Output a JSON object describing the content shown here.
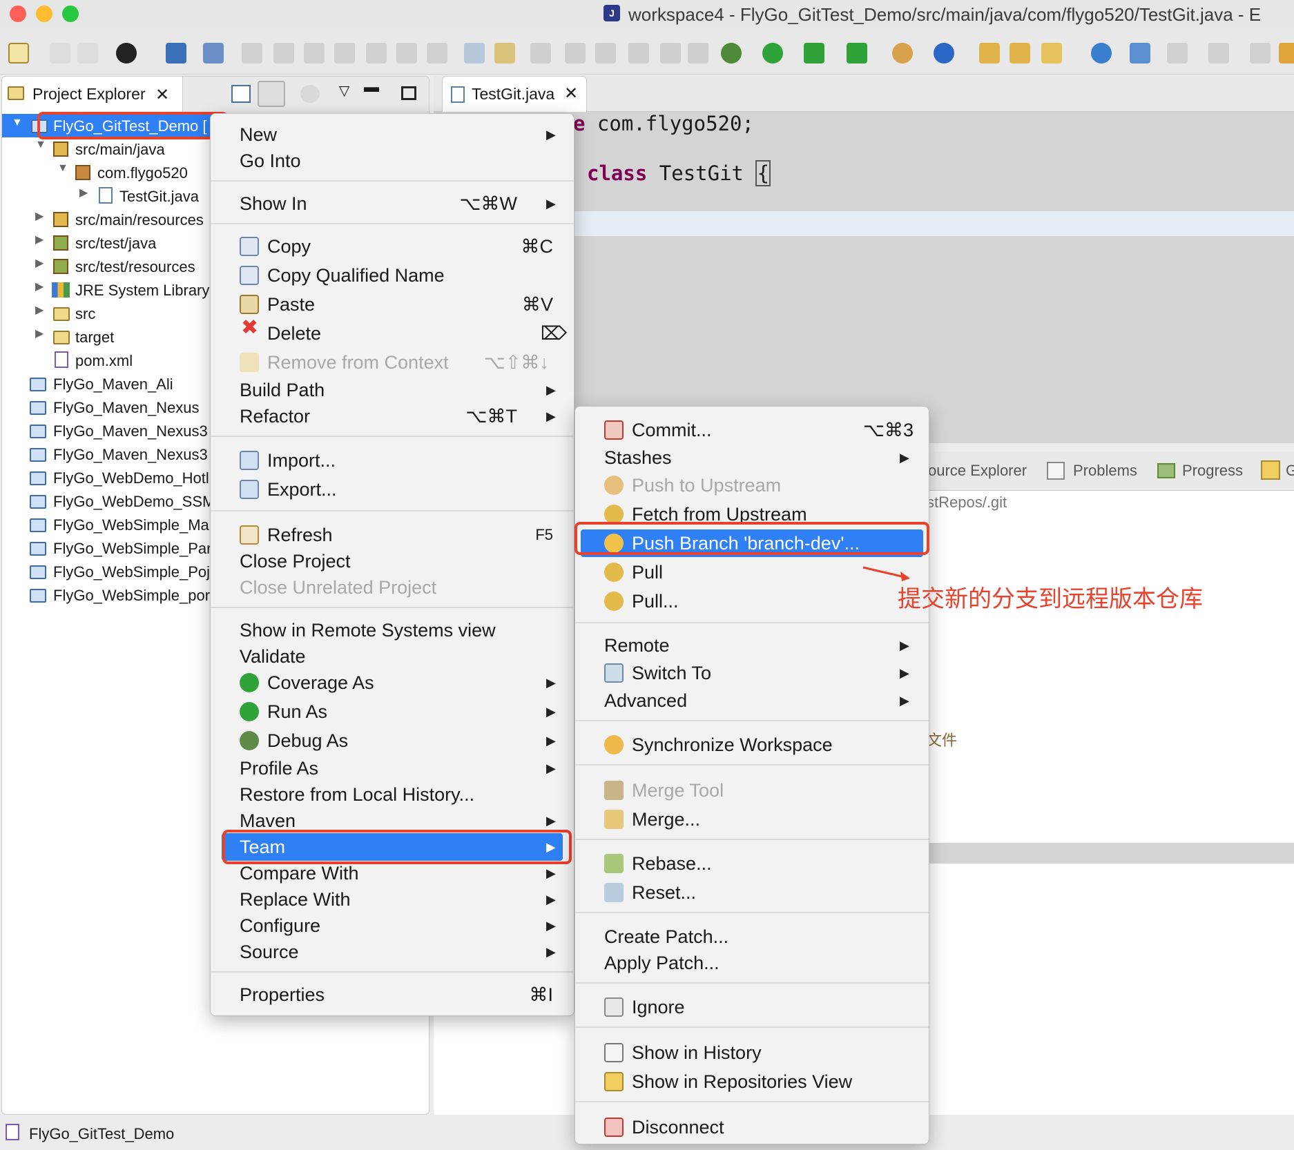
{
  "window": {
    "title": "workspace4 - FlyGo_GitTest_Demo/src/main/java/com/flygo520/TestGit.java - E"
  },
  "explorer": {
    "tab_label": "Project Explorer",
    "tree": [
      {
        "label": "FlyGo_GitTest_Demo [",
        "selected": true
      },
      {
        "label": "src/main/java"
      },
      {
        "label": "com.flygo520"
      },
      {
        "label": "TestGit.java"
      },
      {
        "label": "src/main/resources"
      },
      {
        "label": "src/test/java"
      },
      {
        "label": "src/test/resources"
      },
      {
        "label": "JRE System Library"
      },
      {
        "label": "src"
      },
      {
        "label": "target"
      },
      {
        "label": "pom.xml"
      },
      {
        "label": "FlyGo_Maven_Ali"
      },
      {
        "label": "FlyGo_Maven_Nexus"
      },
      {
        "label": "FlyGo_Maven_Nexus3"
      },
      {
        "label": "FlyGo_Maven_Nexus3"
      },
      {
        "label": "FlyGo_WebDemo_Hotl"
      },
      {
        "label": "FlyGo_WebDemo_SSM"
      },
      {
        "label": "FlyGo_WebSimple_Ma"
      },
      {
        "label": "FlyGo_WebSimple_Par"
      },
      {
        "label": "FlyGo_WebSimple_Poj"
      },
      {
        "label": "FlyGo_WebSimple_por"
      }
    ]
  },
  "editor": {
    "tab_label": "TestGit.java",
    "line1_kw": "e",
    "line1_rest": " com.flygo520;",
    "line2_kw": "class",
    "line2_rest": " TestGit ",
    "line2_brace": "{"
  },
  "bottom_views": {
    "tabs": [
      "ource Explorer",
      "Problems",
      "Progress",
      "G"
    ],
    "repo_path": "stRepos/.git",
    "text_fragment": "文件"
  },
  "context_menu": {
    "items": [
      {
        "label": "New",
        "submenu": true
      },
      {
        "label": "Go Into"
      },
      {
        "label": "Show In",
        "shortcut": "⌥⌘W",
        "submenu": true
      },
      {
        "label": "Copy",
        "shortcut": "⌘C"
      },
      {
        "label": "Copy Qualified Name"
      },
      {
        "label": "Paste",
        "shortcut": "⌘V"
      },
      {
        "label": "Delete",
        "shortcut": "⌦"
      },
      {
        "label": "Remove from Context",
        "shortcut": "⌥⇧⌘↓",
        "disabled": true
      },
      {
        "label": "Build Path",
        "submenu": true
      },
      {
        "label": "Refactor",
        "shortcut": "⌥⌘T",
        "submenu": true
      },
      {
        "label": "Import..."
      },
      {
        "label": "Export..."
      },
      {
        "label": "Refresh",
        "shortcut": "F5"
      },
      {
        "label": "Close Project"
      },
      {
        "label": "Close Unrelated Project",
        "disabled": true
      },
      {
        "label": "Show in Remote Systems view"
      },
      {
        "label": "Validate"
      },
      {
        "label": "Coverage As",
        "submenu": true
      },
      {
        "label": "Run As",
        "submenu": true
      },
      {
        "label": "Debug As",
        "submenu": true
      },
      {
        "label": "Profile As",
        "submenu": true
      },
      {
        "label": "Restore from Local History..."
      },
      {
        "label": "Maven",
        "submenu": true
      },
      {
        "label": "Team",
        "submenu": true,
        "highlighted": true
      },
      {
        "label": "Compare With",
        "submenu": true
      },
      {
        "label": "Replace With",
        "submenu": true
      },
      {
        "label": "Configure",
        "submenu": true
      },
      {
        "label": "Source",
        "submenu": true
      },
      {
        "label": "Properties",
        "shortcut": "⌘I"
      }
    ]
  },
  "team_menu": {
    "items": [
      {
        "label": "Commit...",
        "shortcut": "⌥⌘3"
      },
      {
        "label": "Stashes",
        "submenu": true
      },
      {
        "label": "Push to Upstream",
        "disabled": true
      },
      {
        "label": "Fetch from Upstream"
      },
      {
        "label": "Push Branch 'branch-dev'...",
        "highlighted": true
      },
      {
        "label": "Pull"
      },
      {
        "label": "Pull..."
      },
      {
        "label": "Remote",
        "submenu": true
      },
      {
        "label": "Switch To",
        "submenu": true
      },
      {
        "label": "Advanced",
        "submenu": true
      },
      {
        "label": "Synchronize Workspace"
      },
      {
        "label": "Merge Tool",
        "disabled": true
      },
      {
        "label": "Merge..."
      },
      {
        "label": "Rebase..."
      },
      {
        "label": "Reset..."
      },
      {
        "label": "Create Patch..."
      },
      {
        "label": "Apply Patch..."
      },
      {
        "label": "Ignore"
      },
      {
        "label": "Show in History"
      },
      {
        "label": "Show in Repositories View"
      },
      {
        "label": "Disconnect"
      }
    ]
  },
  "annotation": {
    "text": "提交新的分支到远程版本仓库"
  },
  "statusbar": {
    "text": "FlyGo_GitTest_Demo"
  },
  "colors": {
    "highlight": "#2f7ff5",
    "annotation_red": "#e8412c",
    "keyword": "#7f0055"
  }
}
